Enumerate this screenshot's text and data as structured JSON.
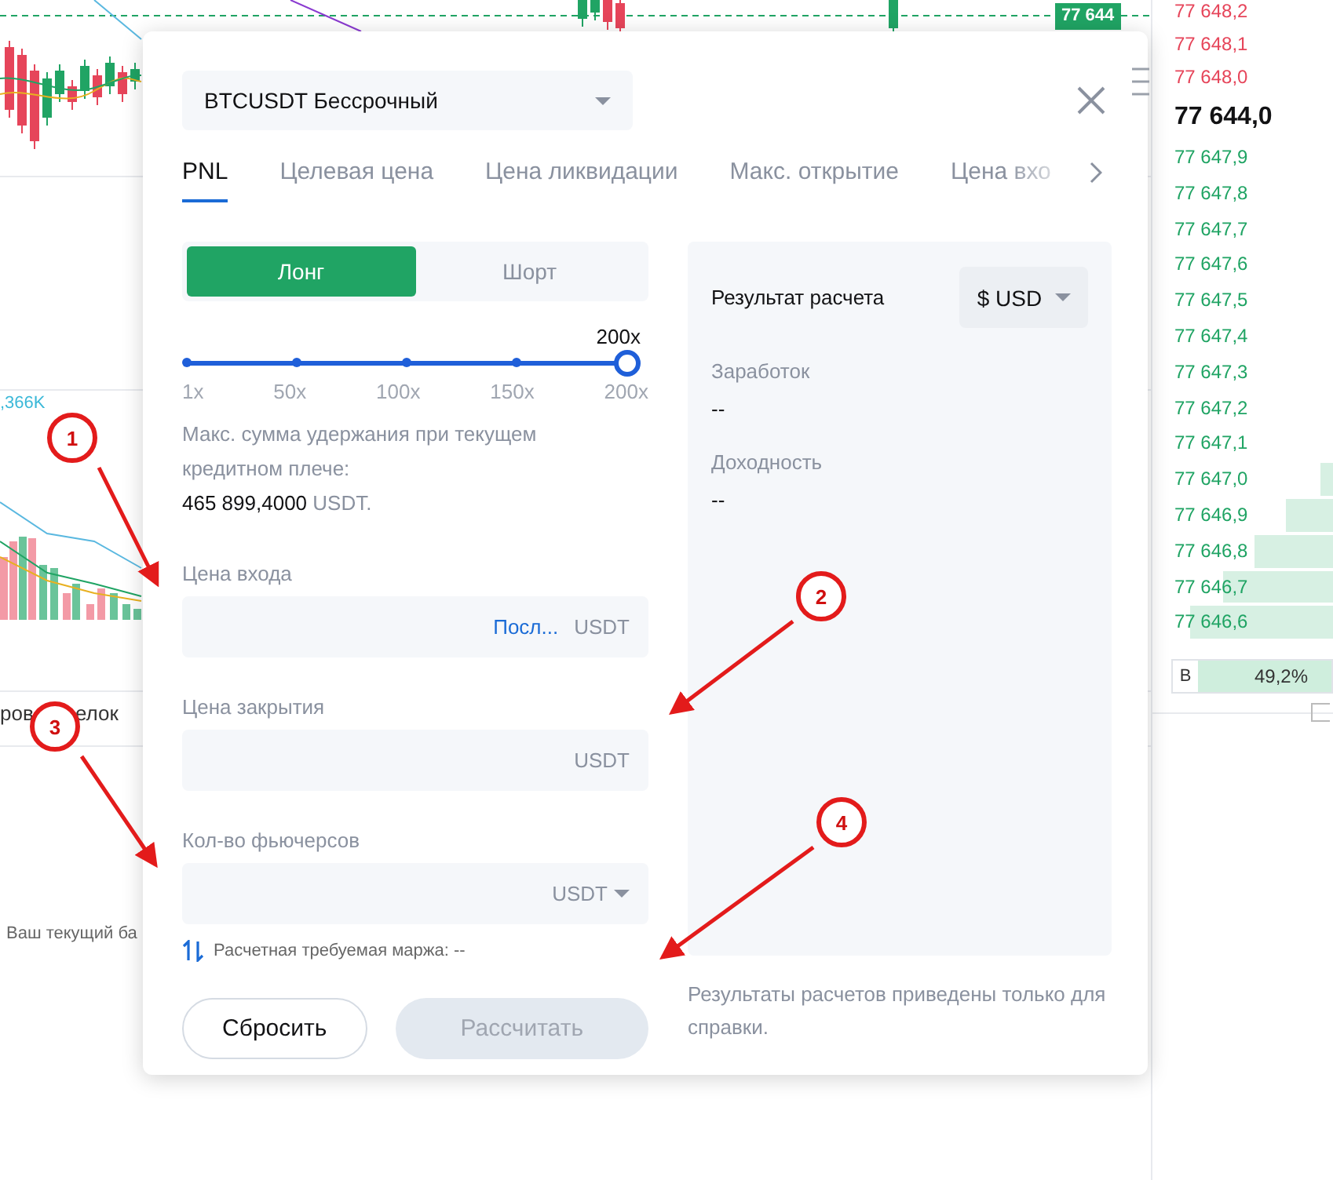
{
  "chart": {
    "price_tag": "77 644",
    "volume_label": ",366K",
    "tab_fragments": [
      "ров",
      "елок"
    ],
    "balance_fragment": "Ваш текущий ба"
  },
  "order_book": {
    "asks": [
      {
        "price": "77 648,2"
      },
      {
        "price": "77 648,1"
      },
      {
        "price": "77 648,0"
      }
    ],
    "last_price": "77 644,0",
    "bids": [
      {
        "price": "77 647,9"
      },
      {
        "price": "77 647,8"
      },
      {
        "price": "77 647,7"
      },
      {
        "price": "77 647,6"
      },
      {
        "price": "77 647,5"
      },
      {
        "price": "77 647,4"
      },
      {
        "price": "77 647,3"
      },
      {
        "price": "77 647,2"
      },
      {
        "price": "77 647,1"
      },
      {
        "price": "77 647,0"
      },
      {
        "price": "77 646,9"
      },
      {
        "price": "77 646,8"
      },
      {
        "price": "77 646,7"
      },
      {
        "price": "77 646,6"
      }
    ],
    "buy_ratio": {
      "side": "B",
      "reading": "49,2%"
    },
    "checkbox": {
      "checked": false
    }
  },
  "modal": {
    "symbol_select": "BTCUSDT Бессрочный",
    "tabs": [
      {
        "label": "PNL",
        "selected": true
      },
      {
        "label": "Целевая цена",
        "selected": false
      },
      {
        "label": "Цена ликвидации",
        "selected": false
      },
      {
        "label": "Макс. открытие",
        "selected": false
      },
      {
        "label": "Цена вхо",
        "selected": false
      }
    ],
    "direction": [
      {
        "label": "Лонг",
        "selected": true
      },
      {
        "label": "Шорт",
        "selected": false
      }
    ],
    "leverage": {
      "value": "200x",
      "level": 1,
      "ticks": [
        "1x",
        "50x",
        "100x",
        "150x",
        "200x"
      ]
    },
    "max_hold": {
      "text": "Макс. сумма удержания при текущем кредитном плече:",
      "amount": "465 899,4000",
      "unit": "USDT."
    },
    "fields": [
      {
        "label": "Цена входа",
        "link": "Посл...",
        "unit": "USDT",
        "dropdown": false
      },
      {
        "label": "Цена закрытия",
        "unit": "USDT",
        "dropdown": false
      },
      {
        "label": "Кол-во фьючерсов",
        "unit": "USDT",
        "dropdown": true
      }
    ],
    "margin_note": "Расчетная требуемая маржа: --",
    "buttons": [
      {
        "label": "Сбросить",
        "disabled": false
      },
      {
        "label": "Рассчитать",
        "disabled": true
      }
    ],
    "result": {
      "title": "Результат расчета",
      "currency": "$ USD",
      "items": [
        {
          "label": "Заработок",
          "value": "--"
        },
        {
          "label": "Доходность",
          "value": "--"
        }
      ]
    },
    "disclaimer": "Результаты расчетов приведены только для справки."
  },
  "annotations": [
    {
      "number": "1"
    },
    {
      "number": "2"
    },
    {
      "number": "3"
    },
    {
      "number": "4"
    }
  ]
}
